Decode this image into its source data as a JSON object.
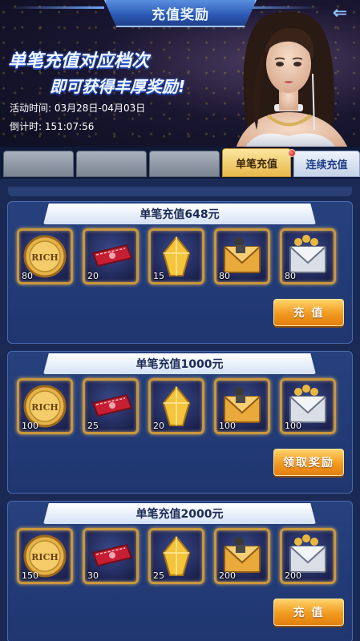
{
  "header": {
    "title": "充值奖励",
    "slogan_line1": "单笔充值对应档次",
    "slogan_line2": "即可获得丰厚奖励!",
    "activity_time": "活动时间: 03月28日-04月03日",
    "countdown": "倒计时:   151:07:56",
    "back_icon": "back-arrow-icon"
  },
  "tabs": [
    {
      "label": ""
    },
    {
      "label": ""
    },
    {
      "label": ""
    },
    {
      "label": "单笔充值",
      "active": true
    },
    {
      "label": "连续充值"
    }
  ],
  "panels": [
    {
      "title": "单笔充值648元",
      "items": [
        {
          "icon": "rich-coin-icon",
          "qty": "80"
        },
        {
          "icon": "red-ticket-icon",
          "qty": "20"
        },
        {
          "icon": "gold-crystal-icon",
          "qty": "15"
        },
        {
          "icon": "gold-envelope-icon",
          "qty": "80"
        },
        {
          "icon": "silver-envelope-icon",
          "qty": "80"
        }
      ],
      "button": "充 值"
    },
    {
      "title": "单笔充值1000元",
      "items": [
        {
          "icon": "rich-coin-icon",
          "qty": "100"
        },
        {
          "icon": "red-ticket-icon",
          "qty": "25"
        },
        {
          "icon": "gold-crystal-icon",
          "qty": "20"
        },
        {
          "icon": "gold-envelope-icon",
          "qty": "100"
        },
        {
          "icon": "silver-envelope-icon",
          "qty": "100"
        }
      ],
      "button": "领取奖励"
    },
    {
      "title": "单笔充值2000元",
      "items": [
        {
          "icon": "rich-coin-icon",
          "qty": "150"
        },
        {
          "icon": "red-ticket-icon",
          "qty": "30"
        },
        {
          "icon": "gold-crystal-icon",
          "qty": "25"
        },
        {
          "icon": "gold-envelope-icon",
          "qty": "200"
        },
        {
          "icon": "silver-envelope-icon",
          "qty": "200"
        }
      ],
      "button": "充 值"
    }
  ],
  "coin_text": "RICH",
  "colors": {
    "accent_gold": "#f19a20",
    "tab_active": "#e8b84b",
    "panel_bg": "#26417e",
    "frame_gold": "#c9973b"
  }
}
